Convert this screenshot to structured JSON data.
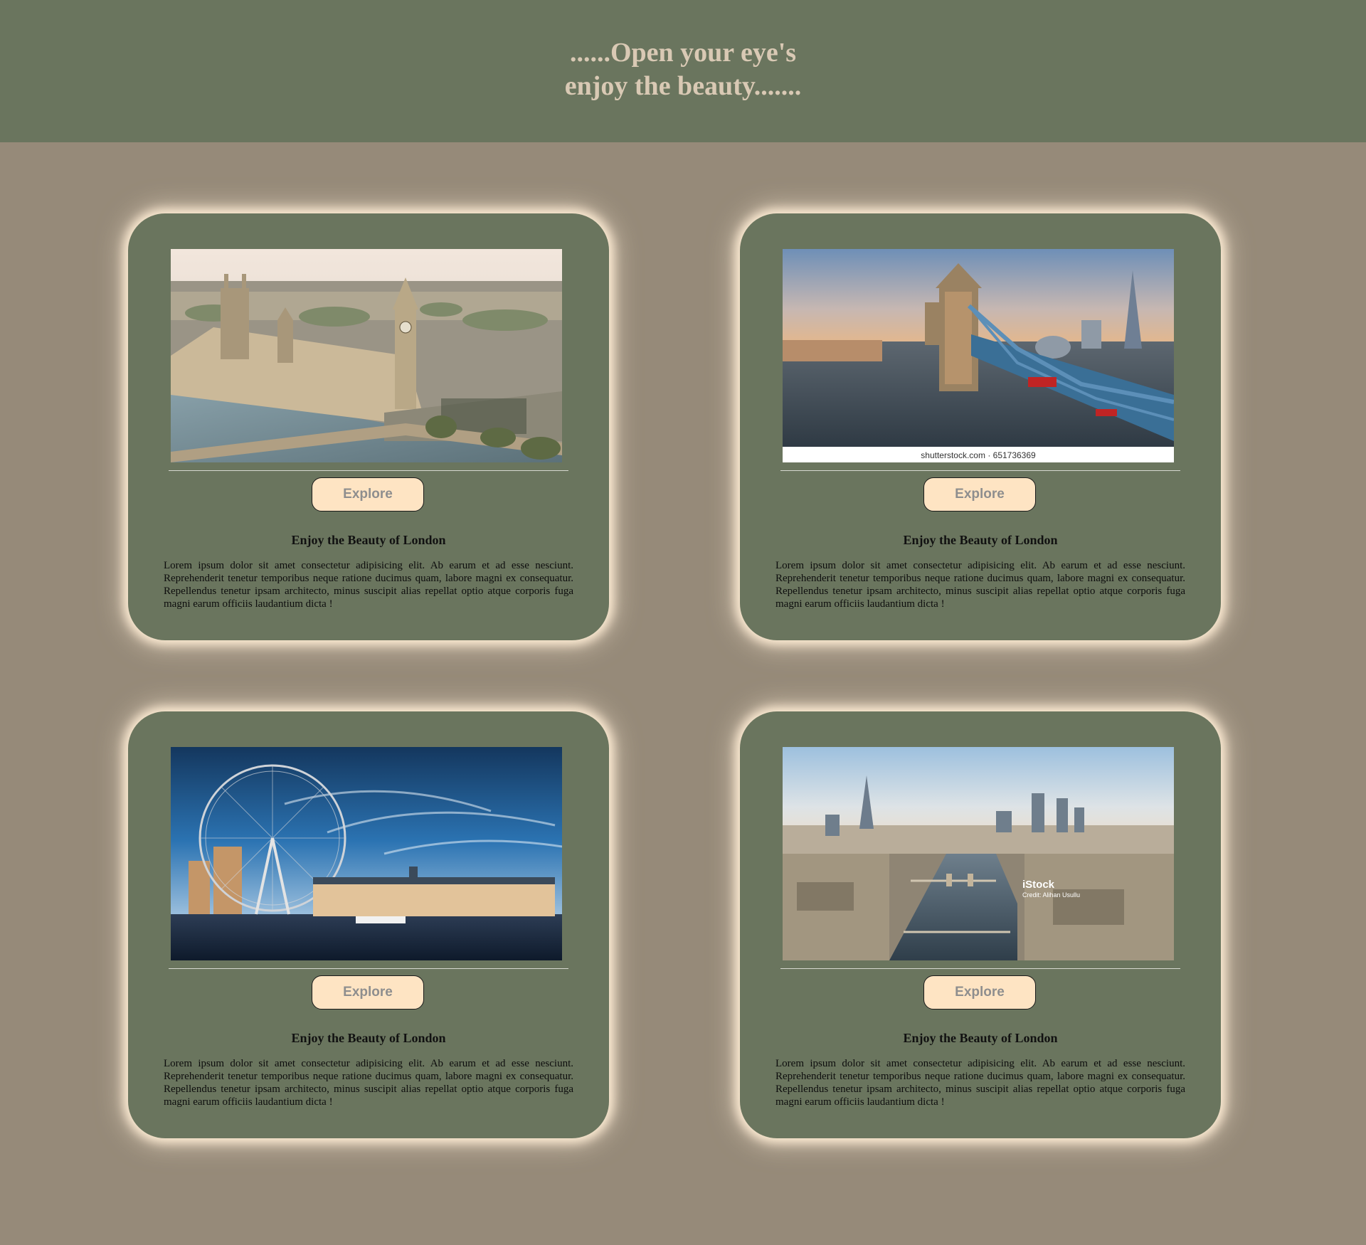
{
  "header": {
    "title_line1": "......Open your eye's",
    "title_line2": "enjoy the beauty......."
  },
  "cards": [
    {
      "image": "Westminster Palace and Big Ben aerial view",
      "button_label": "Explore",
      "title": "Enjoy the Beauty of London",
      "text": "Lorem ipsum dolor sit amet consectetur adipisicing elit. Ab earum et ad esse nesciunt. Reprehenderit tenetur temporibus neque ratione ducimus quam, labore magni ex consequatur. Repellendus tenetur ipsam architecto, minus suscipit alias repellat optio atque corporis fuga magni earum officiis laudantium dicta !"
    },
    {
      "image": "Tower Bridge at sunset",
      "image_caption": "shutterstock.com · 651736369",
      "button_label": "Explore",
      "title": "Enjoy the Beauty of London",
      "text": "Lorem ipsum dolor sit amet consectetur adipisicing elit. Ab earum et ad esse nesciunt. Reprehenderit tenetur temporibus neque ratione ducimus quam, labore magni ex consequatur. Repellendus tenetur ipsam architecto, minus suscipit alias repellat optio atque corporis fuga magni earum officiis laudantium dicta !"
    },
    {
      "image": "London Eye and County Hall on the Thames",
      "button_label": "Explore",
      "title": "Enjoy the Beauty of London",
      "text": "Lorem ipsum dolor sit amet consectetur adipisicing elit. Ab earum et ad esse nesciunt. Reprehenderit tenetur temporibus neque ratione ducimus quam, labore magni ex consequatur. Repellendus tenetur ipsam architecto, minus suscipit alias repellat optio atque corporis fuga magni earum officiis laudantium dicta !"
    },
    {
      "image": "Aerial view of the Thames, Tower Bridge and the Shard",
      "image_watermark": "iStock",
      "image_credit": "Credit: Alihan Usullu",
      "button_label": "Explore",
      "title": "Enjoy the Beauty of London",
      "text": "Lorem ipsum dolor sit amet consectetur adipisicing elit. Ab earum et ad esse nesciunt. Reprehenderit tenetur temporibus neque ratione ducimus quam, labore magni ex consequatur. Repellendus tenetur ipsam architecto, minus suscipit alias repellat optio atque corporis fuga magni earum officiis laudantium dicta !"
    }
  ],
  "colors": {
    "page_background": "#968a79",
    "header_background": "#6a755e",
    "card_background": "#6a755e",
    "card_glow": "#fdebd3",
    "header_text": "#d9c9b4",
    "button_background": "#fee4c3",
    "button_text": "#8e8e8e"
  }
}
